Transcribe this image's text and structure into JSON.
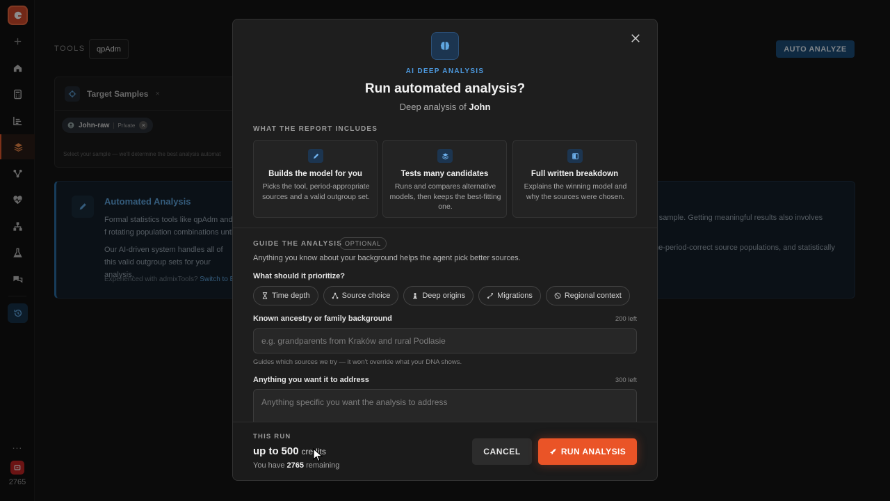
{
  "rail": {
    "credits": "2765",
    "more": "...",
    "items": [
      "add",
      "home",
      "calculator",
      "chart",
      "layers",
      "tree",
      "heart-pulse",
      "hierarchy",
      "flask",
      "chat"
    ]
  },
  "background": {
    "tools_label": "TOOLS",
    "tool_chip": "qpAdm",
    "auto_analyze": "AUTO ANALYZE",
    "target_card": {
      "title": "Target Samples",
      "close": "×",
      "sample_name": "John-raw",
      "sample_privacy": "Private",
      "hint": "Select your sample — we'll determine the best analysis automat"
    },
    "auto_card": {
      "title": "Automated Analysis",
      "p1": "Formal statistics tools like qpAdm and f rotating population combinations until",
      "p2": "Our AI-driven system handles all of this valid outgroup sets for your analysis.",
      "p3_text": "Experienced with admixTools?",
      "p3_link": "Switch to E",
      "right1": "r sample. Getting meaningful results also involves",
      "right2": "ne-period-correct source populations, and statistically"
    }
  },
  "modal": {
    "eyebrow": "AI DEEP ANALYSIS",
    "title": "Run automated analysis?",
    "subtitle_prefix": "Deep analysis of",
    "subtitle_name": "John",
    "includes_label": "WHAT THE REPORT INCLUDES",
    "features": [
      {
        "title": "Builds the model for you",
        "desc": "Picks the tool, period-appropriate sources and a valid outgroup set.",
        "icon": "pencil-icon"
      },
      {
        "title": "Tests many candidates",
        "desc": "Runs and compares alternative models, then keeps the best-fitting one.",
        "icon": "layers-icon"
      },
      {
        "title": "Full written breakdown",
        "desc": "Explains the winning model and why the sources were chosen.",
        "icon": "book-icon"
      }
    ],
    "guide_label": "GUIDE THE ANALYSIS",
    "optional_badge": "OPTIONAL",
    "guide_desc": "Anything you know about your background helps the agent pick better sources.",
    "prioritize_label": "What should it prioritize?",
    "chips": [
      {
        "label": "Time depth",
        "icon": "hourglass-icon"
      },
      {
        "label": "Source choice",
        "icon": "network-icon"
      },
      {
        "label": "Deep origins",
        "icon": "chess-pawn-icon"
      },
      {
        "label": "Migrations",
        "icon": "route-icon"
      },
      {
        "label": "Regional context",
        "icon": "globe-icon"
      }
    ],
    "ancestry_label": "Known ancestry or family background",
    "ancestry_left": "200 left",
    "ancestry_placeholder": "e.g. grandparents from Kraków and rural Podlasie",
    "ancestry_hint": "Guides which sources we try — it won't override what your DNA shows.",
    "address_label": "Anything you want it to address",
    "address_left": "300 left",
    "address_placeholder": "Anything specific you want the analysis to address",
    "footer": {
      "label": "THIS RUN",
      "amount_prefix": "up to",
      "amount": "500",
      "amount_unit": "credits",
      "remaining_prefix": "You have",
      "remaining": "2765",
      "remaining_suffix": "remaining",
      "cancel": "CANCEL",
      "run": "RUN ANALYSIS"
    }
  },
  "colors": {
    "accent": "#ea5427",
    "blue": "#4d9ae0",
    "modal_bg": "#1e1e1e"
  }
}
